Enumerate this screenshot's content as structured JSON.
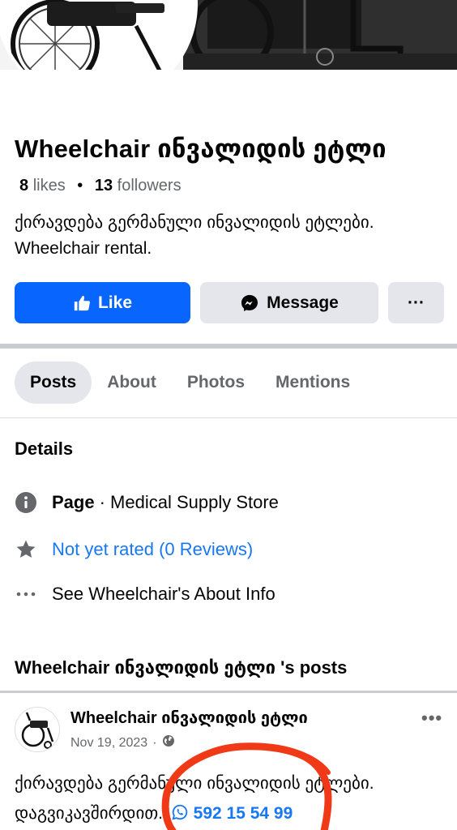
{
  "header": {
    "page_name": "Wheelchair ინვალიდის ეტლი",
    "likes_count": "8",
    "likes_label": "likes",
    "followers_count": "13",
    "followers_label": "followers",
    "bio": "ქირავდება გერმანული ინვალიდის ეტლები.   Wheelchair rental."
  },
  "actions": {
    "like_label": "Like",
    "message_label": "Message",
    "more_label": "···"
  },
  "tabs": [
    {
      "label": "Posts"
    },
    {
      "label": "About"
    },
    {
      "label": "Photos"
    },
    {
      "label": "Mentions"
    }
  ],
  "details": {
    "title": "Details",
    "page_label": "Page",
    "page_category": "· Medical Supply Store",
    "rating_text": "Not yet rated (0 Reviews)",
    "about_info": "See Wheelchair's About Info"
  },
  "posts_section": {
    "title": "Wheelchair ინვალიდის ეტლი 's posts"
  },
  "post": {
    "author": "Wheelchair ინვალიდის ეტლი",
    "date": "Nov 19, 2023",
    "text_line1": "ქირავდება გერმანული ინვალიდის ეტლები.",
    "text_line2": "დაგვიკავშირდით.",
    "phone": "592 15 54 99"
  },
  "colors": {
    "accent": "#0866ff",
    "link": "#1877f2",
    "annotation": "#f03a17"
  }
}
